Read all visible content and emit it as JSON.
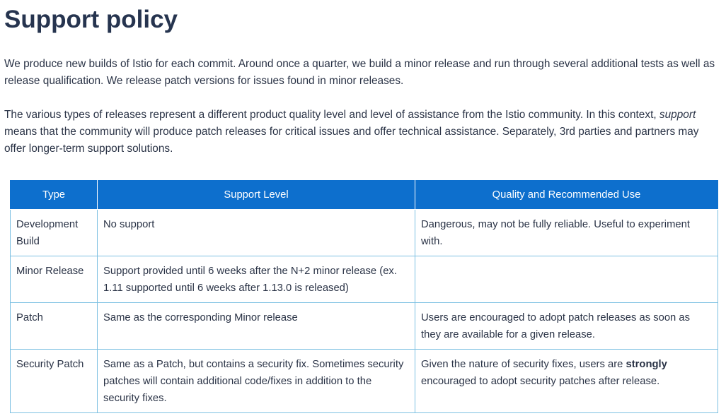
{
  "heading": "Support policy",
  "para1": "We produce new builds of Istio for each commit. Around once a quarter, we build a minor release and run through several additional tests as well as release qualification. We release patch versions for issues found in minor releases.",
  "para2": {
    "before": "The various types of releases represent a different product quality level and level of assistance from the Istio community. In this context, ",
    "emphasis": "support",
    "after": " means that the community will produce patch releases for critical issues and offer technical assistance. Separately, 3rd parties and partners may offer longer-term support solutions."
  },
  "table": {
    "headers": [
      "Type",
      "Support Level",
      "Quality and Recommended Use"
    ],
    "rows": [
      {
        "type": "Development Build",
        "support": "No support",
        "quality": "Dangerous, may not be fully reliable. Useful to experiment with."
      },
      {
        "type": "Minor Release",
        "support": "Support provided until 6 weeks after the N+2 minor release (ex. 1.11 supported until 6 weeks after 1.13.0 is released)",
        "quality": ""
      },
      {
        "type": "Patch",
        "support": "Same as the corresponding Minor release",
        "quality": "Users are encouraged to adopt patch releases as soon as they are available for a given release."
      },
      {
        "type": "Security Patch",
        "support": "Same as a Patch, but contains a security fix. Sometimes security patches will contain additional code/fixes in addition to the security fixes.",
        "quality_before": "Given the nature of security fixes, users are ",
        "quality_strong": "strongly",
        "quality_after": " encouraged to adopt security patches after release."
      }
    ]
  }
}
